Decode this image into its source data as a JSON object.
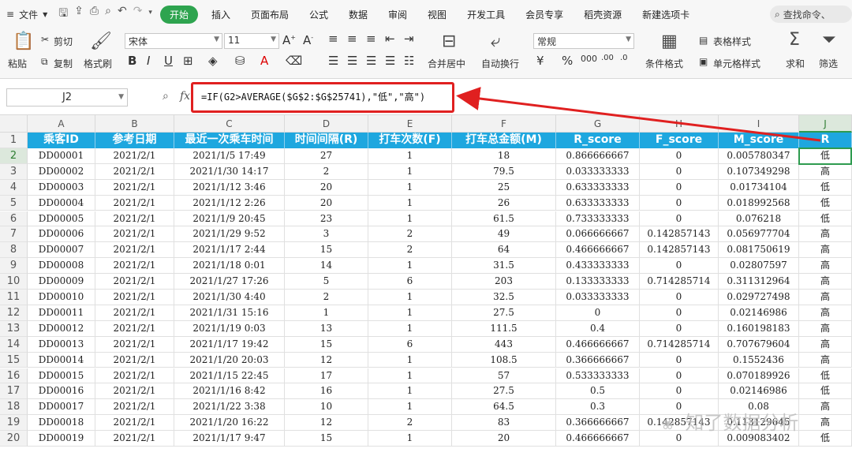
{
  "menubar": {
    "file_label": "文件",
    "tabs": [
      "开始",
      "插入",
      "页面布局",
      "公式",
      "数据",
      "审阅",
      "视图",
      "开发工具",
      "会员专享",
      "稻壳资源",
      "新建选项卡"
    ],
    "search_label": "查找命令、"
  },
  "ribbon": {
    "paste_label": "粘贴",
    "cut_label": "剪切",
    "copy_label": "复制",
    "format_painter_label": "格式刷",
    "font_name": "宋体",
    "font_size": "11",
    "merge_label": "合并居中",
    "wrap_label": "自动换行",
    "number_format": "常规",
    "cond_format_label": "条件格式",
    "table_style_label": "表格样式",
    "cell_style_label": "单元格样式",
    "sum_label": "求和",
    "filter_label": "筛选"
  },
  "formula_bar": {
    "name_box": "J2",
    "fx": "fx",
    "formula": "=IF(G2>AVERAGE($G$2:$G$25741),\"低\",\"高\")"
  },
  "sheet": {
    "columns": [
      "A",
      "B",
      "C",
      "D",
      "E",
      "F",
      "G",
      "H",
      "I",
      "J"
    ],
    "selected_column": "J",
    "selected_row": 2,
    "header_row": [
      "乘客ID",
      "参考日期",
      "最近一次乘车时间",
      "时间间隔(R)",
      "打车次数(F)",
      "打车总金额(M)",
      "R_score",
      "F_score",
      "M_score",
      "R"
    ],
    "rows": [
      [
        "DD00001",
        "2021/2/1",
        "2021/1/5 17:49",
        "27",
        "1",
        "18",
        "0.866666667",
        "0",
        "0.005780347",
        "低"
      ],
      [
        "DD00002",
        "2021/2/1",
        "2021/1/30 14:17",
        "2",
        "1",
        "79.5",
        "0.033333333",
        "0",
        "0.107349298",
        "高"
      ],
      [
        "DD00003",
        "2021/2/1",
        "2021/1/12 3:46",
        "20",
        "1",
        "25",
        "0.633333333",
        "0",
        "0.01734104",
        "低"
      ],
      [
        "DD00004",
        "2021/2/1",
        "2021/1/12 2:26",
        "20",
        "1",
        "26",
        "0.633333333",
        "0",
        "0.018992568",
        "低"
      ],
      [
        "DD00005",
        "2021/2/1",
        "2021/1/9 20:45",
        "23",
        "1",
        "61.5",
        "0.733333333",
        "0",
        "0.076218",
        "低"
      ],
      [
        "DD00006",
        "2021/2/1",
        "2021/1/29 9:52",
        "3",
        "2",
        "49",
        "0.066666667",
        "0.142857143",
        "0.056977704",
        "高"
      ],
      [
        "DD00007",
        "2021/2/1",
        "2021/1/17 2:44",
        "15",
        "2",
        "64",
        "0.466666667",
        "0.142857143",
        "0.081750619",
        "高"
      ],
      [
        "DD00008",
        "2021/2/1",
        "2021/1/18 0:01",
        "14",
        "1",
        "31.5",
        "0.433333333",
        "0",
        "0.02807597",
        "高"
      ],
      [
        "DD00009",
        "2021/2/1",
        "2021/1/27 17:26",
        "5",
        "6",
        "203",
        "0.133333333",
        "0.714285714",
        "0.311312964",
        "高"
      ],
      [
        "DD00010",
        "2021/2/1",
        "2021/1/30 4:40",
        "2",
        "1",
        "32.5",
        "0.033333333",
        "0",
        "0.029727498",
        "高"
      ],
      [
        "DD00011",
        "2021/2/1",
        "2021/1/31 15:16",
        "1",
        "1",
        "27.5",
        "0",
        "0",
        "0.02146986",
        "高"
      ],
      [
        "DD00012",
        "2021/2/1",
        "2021/1/19 0:03",
        "13",
        "1",
        "111.5",
        "0.4",
        "0",
        "0.160198183",
        "高"
      ],
      [
        "DD00013",
        "2021/2/1",
        "2021/1/17 19:42",
        "15",
        "6",
        "443",
        "0.466666667",
        "0.714285714",
        "0.707679604",
        "高"
      ],
      [
        "DD00014",
        "2021/2/1",
        "2021/1/20 20:03",
        "12",
        "1",
        "108.5",
        "0.366666667",
        "0",
        "0.1552436",
        "高"
      ],
      [
        "DD00015",
        "2021/2/1",
        "2021/1/15 22:45",
        "17",
        "1",
        "57",
        "0.533333333",
        "0",
        "0.070189926",
        "低"
      ],
      [
        "DD00016",
        "2021/2/1",
        "2021/1/16 8:42",
        "16",
        "1",
        "27.5",
        "0.5",
        "0",
        "0.02146986",
        "低"
      ],
      [
        "DD00017",
        "2021/2/1",
        "2021/1/22 3:38",
        "10",
        "1",
        "64.5",
        "0.3",
        "0",
        "0.08",
        "高"
      ],
      [
        "DD00018",
        "2021/2/1",
        "2021/1/20 16:22",
        "12",
        "2",
        "83",
        "0.366666667",
        "0.142857143",
        "0.113129645",
        "高"
      ],
      [
        "DD00019",
        "2021/2/1",
        "2021/1/17 9:47",
        "15",
        "1",
        "20",
        "0.466666667",
        "0",
        "0.009083402",
        "低"
      ]
    ]
  },
  "watermark": "知了数据分析",
  "colors": {
    "accent_green": "#2ea44f",
    "header_blue": "#1ea7df",
    "highlight_red": "#e02020"
  }
}
